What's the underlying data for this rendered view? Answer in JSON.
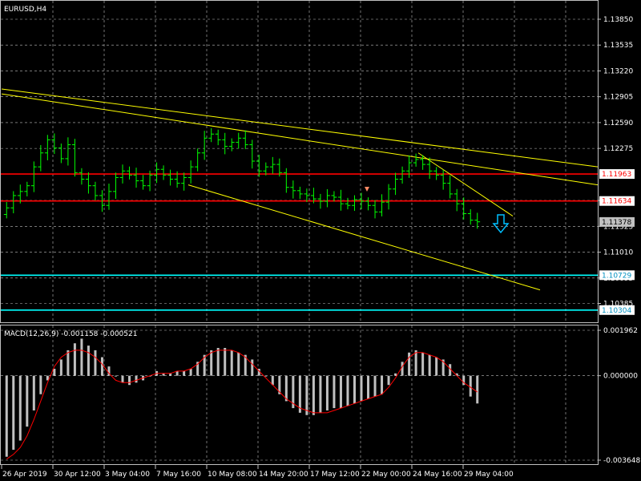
{
  "chart_data": [
    {
      "type": "candlestick",
      "title": "EURUSD,H4",
      "symbol": "EURUSD",
      "timeframe": "H4",
      "ylim": [
        1.1,
        1.1395
      ],
      "y_ticks": [
        "1.13850",
        "1.13535",
        "1.13220",
        "1.12905",
        "1.12590",
        "1.12275",
        "1.11640",
        "1.11325",
        "1.11010",
        "1.10695",
        "1.10385"
      ],
      "x_ticks": [
        "26 Apr 2019",
        "30 Apr 12:00",
        "3 May 04:00",
        "7 May 16:00",
        "10 May 08:00",
        "14 May 20:00",
        "17 May 12:00",
        "22 May 00:00",
        "24 May 16:00",
        "29 May 04:00"
      ],
      "grid": true,
      "colors": {
        "background": "#000000",
        "bars": "#00ff00",
        "grid": "#c0c0c0",
        "trendlines": "#ffff00",
        "resistance": "#ff0000",
        "support": "#00ffff",
        "arrow": "#00bfff"
      },
      "horizontal_lines": [
        {
          "label": "1.11963",
          "value": 1.11963,
          "color": "#ff0000"
        },
        {
          "label": "1.11634",
          "value": 1.11634,
          "color": "#ff0000"
        },
        {
          "label": "1.10729",
          "value": 1.10729,
          "color": "#00ffff"
        },
        {
          "label": "1.10304",
          "value": 1.10304,
          "color": "#00ffff"
        }
      ],
      "current_price": {
        "label": "1.11378",
        "value": 1.11378
      },
      "signal_arrow": {
        "direction": "down",
        "color": "#00bfff"
      },
      "closes": [
        1.1155,
        1.117,
        1.1175,
        1.1182,
        1.1205,
        1.1222,
        1.1238,
        1.1228,
        1.1215,
        1.1232,
        1.1198,
        1.119,
        1.1182,
        1.117,
        1.1158,
        1.1175,
        1.1192,
        1.12,
        1.1195,
        1.1188,
        1.1182,
        1.1195,
        1.1202,
        1.1195,
        1.119,
        1.1185,
        1.1192,
        1.1205,
        1.1222,
        1.124,
        1.1245,
        1.1238,
        1.123,
        1.1235,
        1.124,
        1.1232,
        1.1212,
        1.12,
        1.1205,
        1.1208,
        1.1198,
        1.118,
        1.1176,
        1.1172,
        1.117,
        1.1166,
        1.1163,
        1.117,
        1.1168,
        1.116,
        1.1158,
        1.1165,
        1.1163,
        1.1158,
        1.115,
        1.1162,
        1.1178,
        1.119,
        1.12,
        1.121,
        1.1214,
        1.1208,
        1.12,
        1.1195,
        1.1185,
        1.1172,
        1.116,
        1.1148,
        1.114,
        1.1138
      ]
    },
    {
      "type": "histogram+line",
      "title": "MACD(12,26,9) -0.001158 -0.000521",
      "indicator": "MACD",
      "params": [
        12,
        26,
        9
      ],
      "main_value": -0.001158,
      "signal_value": -0.000521,
      "ylim": [
        -0.003648,
        0.001962
      ],
      "y_ticks": [
        "0.001962",
        "0.000000",
        "-0.003648"
      ],
      "colors": {
        "histogram": "#c0c0c0",
        "signal": "#ff0000"
      },
      "histogram": [
        -0.0035,
        -0.0032,
        -0.0028,
        -0.0022,
        -0.0015,
        -0.0008,
        -0.0002,
        0.0003,
        0.0007,
        0.0011,
        0.0014,
        0.0016,
        0.0013,
        0.0011,
        0.0008,
        0.0004,
        0.0,
        -0.0003,
        -0.0004,
        -0.0003,
        -0.0002,
        0.0,
        0.0002,
        0.0001,
        0.0001,
        0.0002,
        0.0002,
        0.0003,
        0.0006,
        0.0009,
        0.0011,
        0.0012,
        0.0012,
        0.0011,
        0.001,
        0.0009,
        0.0007,
        0.0003,
        0.0,
        -0.0004,
        -0.0008,
        -0.0011,
        -0.0014,
        -0.0016,
        -0.0017,
        -0.0017,
        -0.0016,
        -0.0015,
        -0.0014,
        -0.0014,
        -0.0013,
        -0.0012,
        -0.0011,
        -0.001,
        -0.0009,
        -0.0008,
        -0.0004,
        0.0001,
        0.0006,
        0.001,
        0.0011,
        0.001,
        0.0009,
        0.0008,
        0.0007,
        0.0005,
        0.0001,
        -0.0004,
        -0.0009,
        -0.0012
      ],
      "signal": [
        -0.0036,
        -0.0034,
        -0.0031,
        -0.0026,
        -0.0019,
        -0.0011,
        -0.0003,
        0.0004,
        0.0008,
        0.001,
        0.0011,
        0.0011,
        0.001,
        0.0008,
        0.0005,
        0.0001,
        -0.0002,
        -0.0003,
        -0.0003,
        -0.0002,
        -0.0001,
        0.0,
        0.0001,
        0.0001,
        0.0001,
        0.0002,
        0.0002,
        0.0003,
        0.0005,
        0.0008,
        0.001,
        0.0011,
        0.0011,
        0.0011,
        0.001,
        0.0008,
        0.0005,
        0.0002,
        -0.0001,
        -0.0004,
        -0.0007,
        -0.001,
        -0.0012,
        -0.0014,
        -0.0015,
        -0.0016,
        -0.0016,
        -0.0016,
        -0.0015,
        -0.0014,
        -0.0013,
        -0.0012,
        -0.0011,
        -0.001,
        -0.0009,
        -0.0008,
        -0.0005,
        -0.0001,
        0.0004,
        0.0008,
        0.001,
        0.001,
        0.0009,
        0.0008,
        0.0006,
        0.0003,
        0.0,
        -0.0003,
        -0.0005,
        -0.0007
      ]
    }
  ]
}
